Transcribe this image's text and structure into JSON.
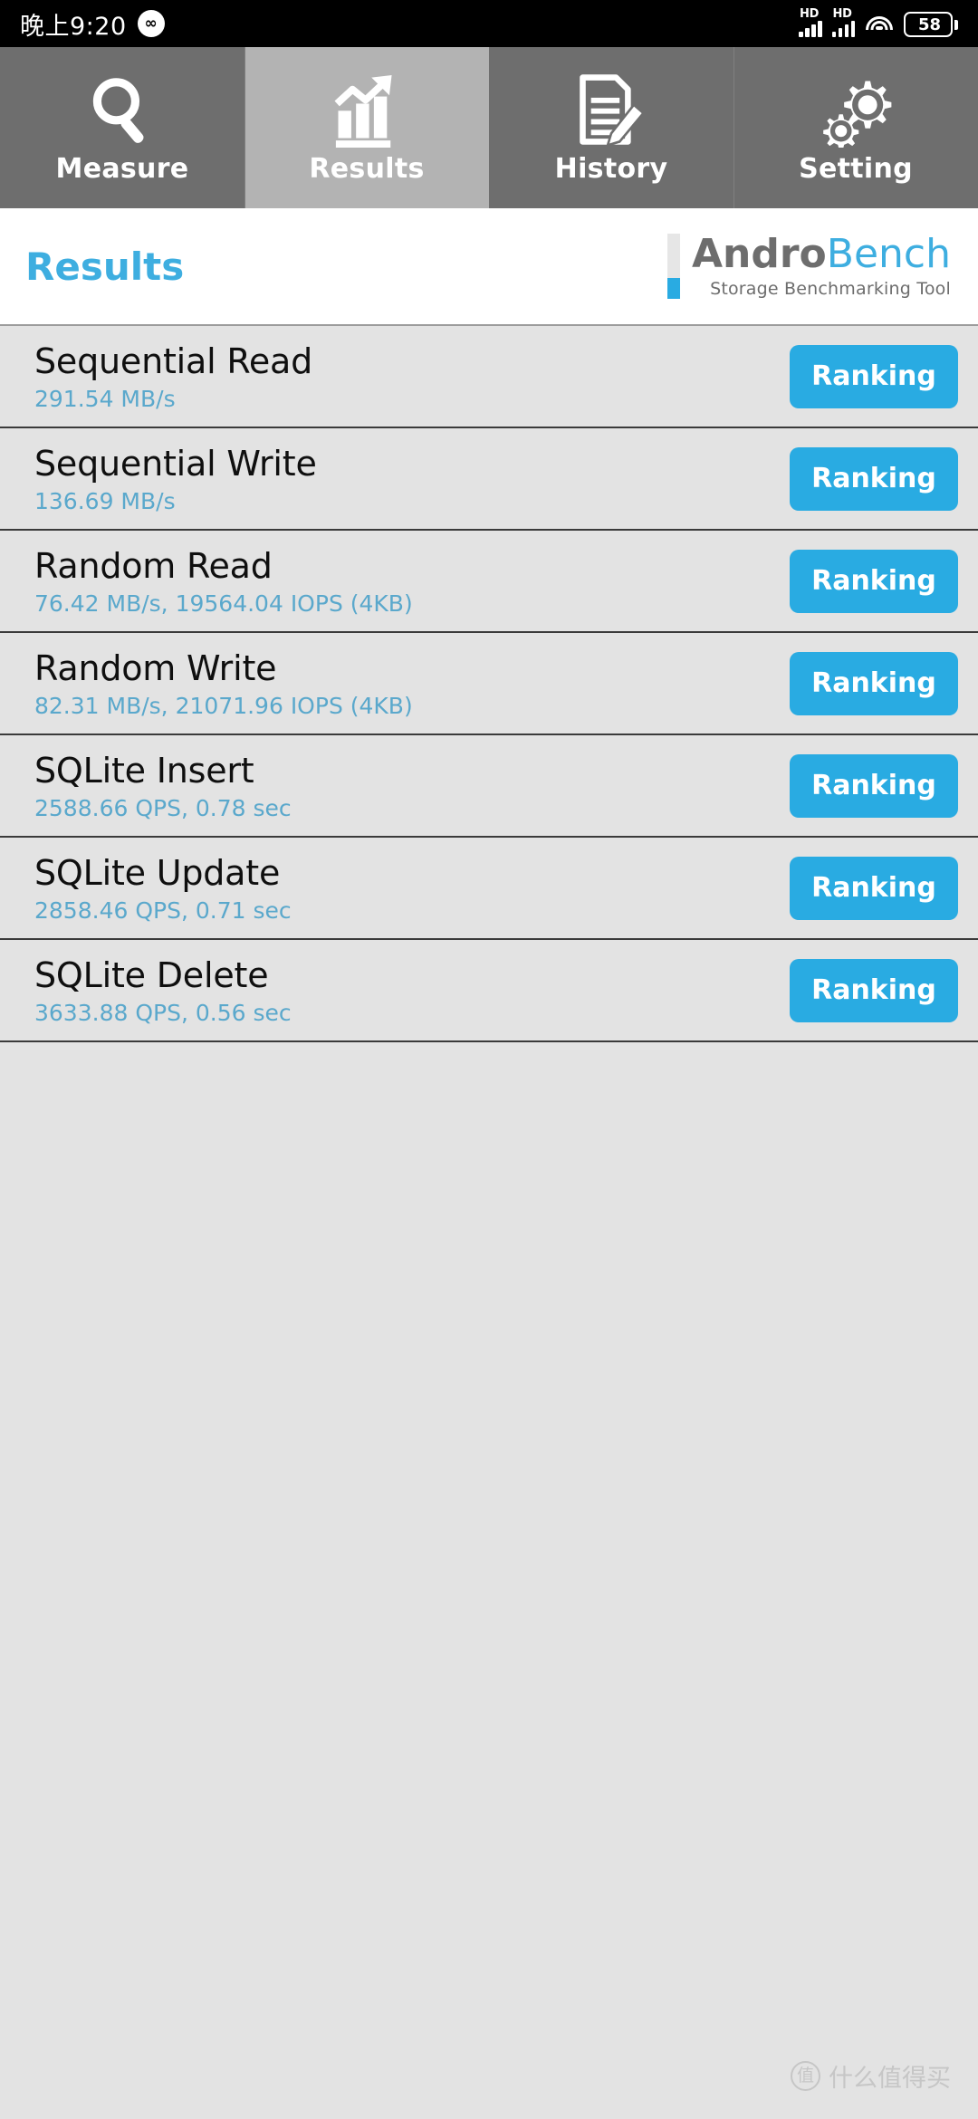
{
  "status_bar": {
    "time": "晚上9:20",
    "app_icon": "∞",
    "signal_1_label": "HD",
    "signal_2_label": "HD",
    "battery_level": "58"
  },
  "tabs": [
    {
      "label": "Measure",
      "icon": "magnifier-icon",
      "active": false
    },
    {
      "label": "Results",
      "icon": "bar-chart-arrow-icon",
      "active": true
    },
    {
      "label": "History",
      "icon": "document-pencil-icon",
      "active": false
    },
    {
      "label": "Setting",
      "icon": "gears-icon",
      "active": false
    }
  ],
  "header": {
    "title": "Results",
    "brand_name_part1": "Andro",
    "brand_name_part2": "Bench",
    "brand_subtitle": "Storage Benchmarking Tool"
  },
  "colors": {
    "accent_blue": "#29abe2",
    "title_blue": "#3eaee0",
    "value_blue": "#5aa8cc",
    "tab_inactive": "#6e6e6e",
    "tab_active": "#b3b3b3",
    "list_bg": "#e3e3e3"
  },
  "results": [
    {
      "title": "Sequential Read",
      "value": "291.54 MB/s",
      "button": "Ranking"
    },
    {
      "title": "Sequential Write",
      "value": "136.69 MB/s",
      "button": "Ranking"
    },
    {
      "title": "Random Read",
      "value": "76.42 MB/s, 19564.04 IOPS (4KB)",
      "button": "Ranking"
    },
    {
      "title": "Random Write",
      "value": "82.31 MB/s, 21071.96 IOPS (4KB)",
      "button": "Ranking"
    },
    {
      "title": "SQLite Insert",
      "value": "2588.66 QPS, 0.78 sec",
      "button": "Ranking"
    },
    {
      "title": "SQLite Update",
      "value": "2858.46 QPS, 0.71 sec",
      "button": "Ranking"
    },
    {
      "title": "SQLite Delete",
      "value": "3633.88 QPS, 0.56 sec",
      "button": "Ranking"
    }
  ],
  "watermark": {
    "badge": "值",
    "text": "什么值得买"
  }
}
